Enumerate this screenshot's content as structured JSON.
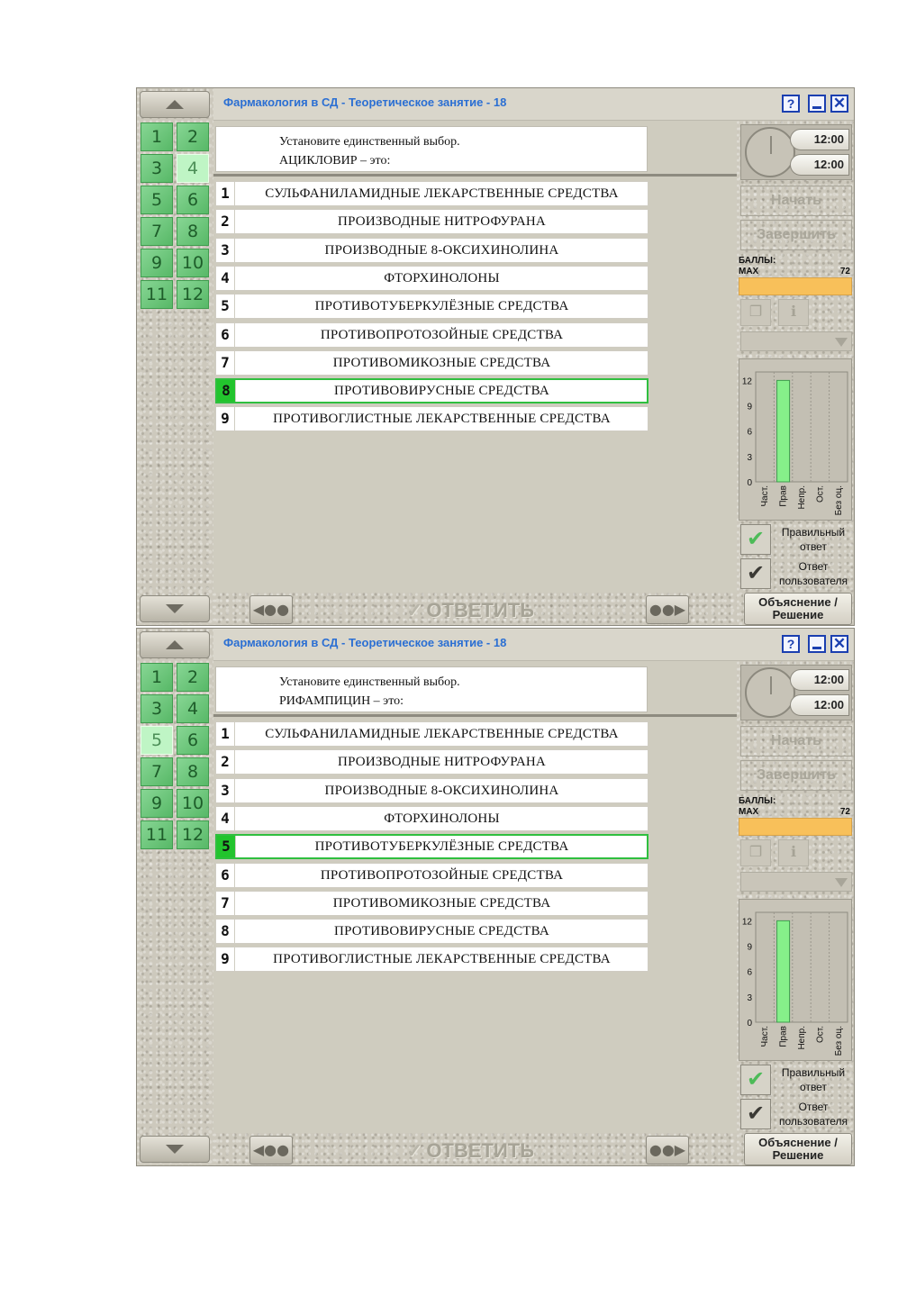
{
  "panels": [
    {
      "title": "Фармакология в СД - Теоретическое занятие - 18",
      "window_buttons": {
        "help": "?",
        "close": "✕"
      },
      "question_numbers": [
        "1",
        "2",
        "3",
        "4",
        "5",
        "6",
        "7",
        "8",
        "9",
        "10",
        "11",
        "12"
      ],
      "current_question": "4",
      "instruction": "Установите единственный выбор.",
      "question": "АЦИКЛОВИР – это:",
      "answers": [
        {
          "num": "1",
          "label": "СУЛЬФАНИЛАМИДНЫЕ ЛЕКАРСТВЕННЫЕ СРЕДСТВА"
        },
        {
          "num": "2",
          "label": "ПРОИЗВОДНЫЕ НИТРОФУРАНА"
        },
        {
          "num": "3",
          "label": "ПРОИЗВОДНЫЕ 8-ОКСИХИНОЛИНА"
        },
        {
          "num": "4",
          "label": "ФТОРХИНОЛОНЫ"
        },
        {
          "num": "5",
          "label": "ПРОТИВОТУБЕРКУЛЁЗНЫЕ СРЕДСТВА"
        },
        {
          "num": "6",
          "label": "ПРОТИВОПРОТОЗОЙНЫЕ СРЕДСТВА"
        },
        {
          "num": "7",
          "label": "ПРОТИВОМИКОЗНЫЕ СРЕДСТВА"
        },
        {
          "num": "8",
          "label": "ПРОТИВОВИРУСНЫЕ СРЕДСТВА"
        },
        {
          "num": "9",
          "label": "ПРОТИВОГЛИСТНЫЕ ЛЕКАРСТВЕННЫЕ СРЕДСТВА"
        }
      ],
      "selected_answer": "8",
      "timer": {
        "time1": "12:00",
        "time2": "12:00"
      },
      "buttons": {
        "start": "Начать",
        "finish": "Завершить",
        "answer": "ОТВЕТИТЬ",
        "explain_line1": "Объяснение /",
        "explain_line2": "Решение"
      },
      "score": {
        "label": "БАЛЛЫ:",
        "max_label": "MAX",
        "max_value": "72"
      },
      "legend": {
        "correct_line1": "Правильный",
        "correct_line2": "ответ",
        "user_line1": "Ответ",
        "user_line2": "пользователя"
      }
    },
    {
      "title": "Фармакология в СД - Теоретическое занятие - 18",
      "window_buttons": {
        "help": "?",
        "close": "✕"
      },
      "question_numbers": [
        "1",
        "2",
        "3",
        "4",
        "5",
        "6",
        "7",
        "8",
        "9",
        "10",
        "11",
        "12"
      ],
      "current_question": "5",
      "instruction": "Установите единственный выбор.",
      "question": "РИФАМПИЦИН – это:",
      "answers": [
        {
          "num": "1",
          "label": "СУЛЬФАНИЛАМИДНЫЕ ЛЕКАРСТВЕННЫЕ СРЕДСТВА"
        },
        {
          "num": "2",
          "label": "ПРОИЗВОДНЫЕ НИТРОФУРАНА"
        },
        {
          "num": "3",
          "label": "ПРОИЗВОДНЫЕ 8-ОКСИХИНОЛИНА"
        },
        {
          "num": "4",
          "label": "ФТОРХИНОЛОНЫ"
        },
        {
          "num": "5",
          "label": "ПРОТИВОТУБЕРКУЛЁЗНЫЕ СРЕДСТВА"
        },
        {
          "num": "6",
          "label": "ПРОТИВОПРОТОЗОЙНЫЕ СРЕДСТВА"
        },
        {
          "num": "7",
          "label": "ПРОТИВОМИКОЗНЫЕ СРЕДСТВА"
        },
        {
          "num": "8",
          "label": "ПРОТИВОВИРУСНЫЕ СРЕДСТВА"
        },
        {
          "num": "9",
          "label": "ПРОТИВОГЛИСТНЫЕ ЛЕКАРСТВЕННЫЕ СРЕДСТВА"
        }
      ],
      "selected_answer": "5",
      "timer": {
        "time1": "12:00",
        "time2": "12:00"
      },
      "buttons": {
        "start": "Начать",
        "finish": "Завершить",
        "answer": "ОТВЕТИТЬ",
        "explain_line1": "Объяснение /",
        "explain_line2": "Решение"
      },
      "score": {
        "label": "БАЛЛЫ:",
        "max_label": "MAX",
        "max_value": "72"
      },
      "legend": {
        "correct_line1": "Правильный",
        "correct_line2": "ответ",
        "user_line1": "Ответ",
        "user_line2": "пользователя"
      }
    }
  ],
  "colors": {
    "question_green": "#5fc870",
    "selected_green": "#22c42d",
    "score_bar": "#f8c05a",
    "title_blue": "#2b6fd3",
    "bar_green": "#86f08a"
  },
  "chart_data": [
    {
      "type": "bar",
      "categories": [
        "Част.",
        "Прав",
        "Непр.",
        "Ост.",
        "Без оц."
      ],
      "values": [
        0,
        12,
        0,
        0,
        0
      ],
      "ylim": [
        0,
        13
      ],
      "yticks": [
        "0",
        "3",
        "6",
        "9",
        "12"
      ]
    },
    {
      "type": "bar",
      "categories": [
        "Част.",
        "Прав",
        "Непр.",
        "Ост.",
        "Без оц."
      ],
      "values": [
        0,
        12,
        0,
        0,
        0
      ],
      "ylim": [
        0,
        13
      ],
      "yticks": [
        "0",
        "3",
        "6",
        "9",
        "12"
      ]
    }
  ]
}
